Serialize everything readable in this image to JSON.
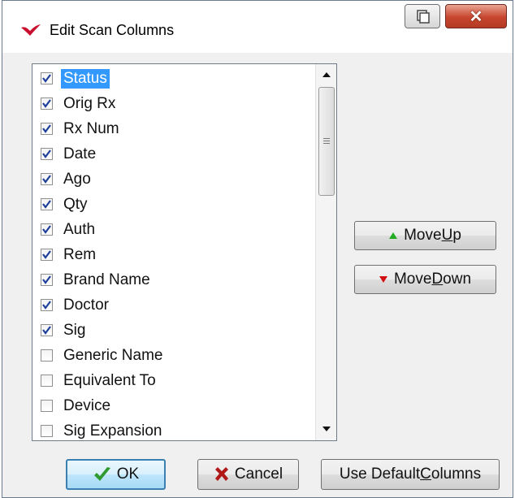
{
  "window": {
    "title": "Edit Scan Columns"
  },
  "columns": [
    {
      "label": "Status",
      "checked": true,
      "selected": true
    },
    {
      "label": "Orig Rx",
      "checked": true
    },
    {
      "label": "Rx Num",
      "checked": true
    },
    {
      "label": "Date",
      "checked": true
    },
    {
      "label": "Ago",
      "checked": true
    },
    {
      "label": "Qty",
      "checked": true
    },
    {
      "label": "Auth",
      "checked": true
    },
    {
      "label": "Rem",
      "checked": true
    },
    {
      "label": "Brand Name",
      "checked": true
    },
    {
      "label": "Doctor",
      "checked": true
    },
    {
      "label": "Sig",
      "checked": true
    },
    {
      "label": "Generic Name",
      "checked": false
    },
    {
      "label": "Equivalent To",
      "checked": false
    },
    {
      "label": "Device",
      "checked": false
    },
    {
      "label": "Sig Expansion",
      "checked": false
    }
  ],
  "buttons": {
    "move_up_pre": "Move ",
    "move_up_key": "U",
    "move_up_post": "p",
    "move_down_pre": "Move ",
    "move_down_key": "D",
    "move_down_post": "own",
    "ok": "OK",
    "cancel": "Cancel",
    "default_pre": "Use Default ",
    "default_key": "C",
    "default_post": "olumns"
  },
  "colors": {
    "selection": "#3399ff",
    "close_button": "#c6452d"
  }
}
